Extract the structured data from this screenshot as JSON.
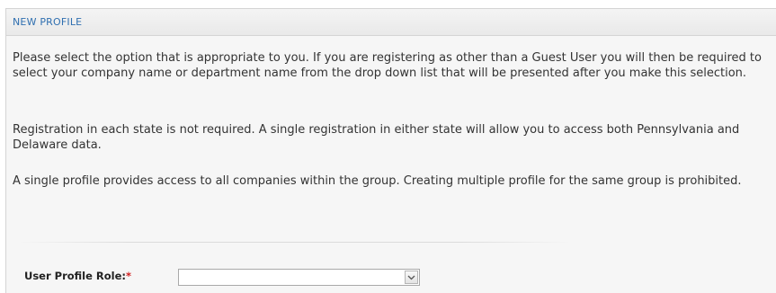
{
  "panel": {
    "title": "NEW PROFILE"
  },
  "content": {
    "paragraphs": [
      "Please select the option that is appropriate to you. If you are registering as other than a Guest User you will then be required to select your company name or department name from the drop down list that will be presented after you make this selection.",
      "Registration in each state is not required. A single registration in either state will allow you to access both Pennsylvania and Delaware data.",
      "A single profile provides access to all companies within the group. Creating multiple profile for the same group is prohibited."
    ]
  },
  "form": {
    "role_label": "User Profile Role:",
    "required_marker": "*",
    "role_select": {
      "selected": "",
      "icon": "chevron-down-icon"
    }
  },
  "colors": {
    "title": "#2f6fb0",
    "required": "#d22020",
    "panel_bg": "#f6f6f6",
    "text": "#333333"
  }
}
